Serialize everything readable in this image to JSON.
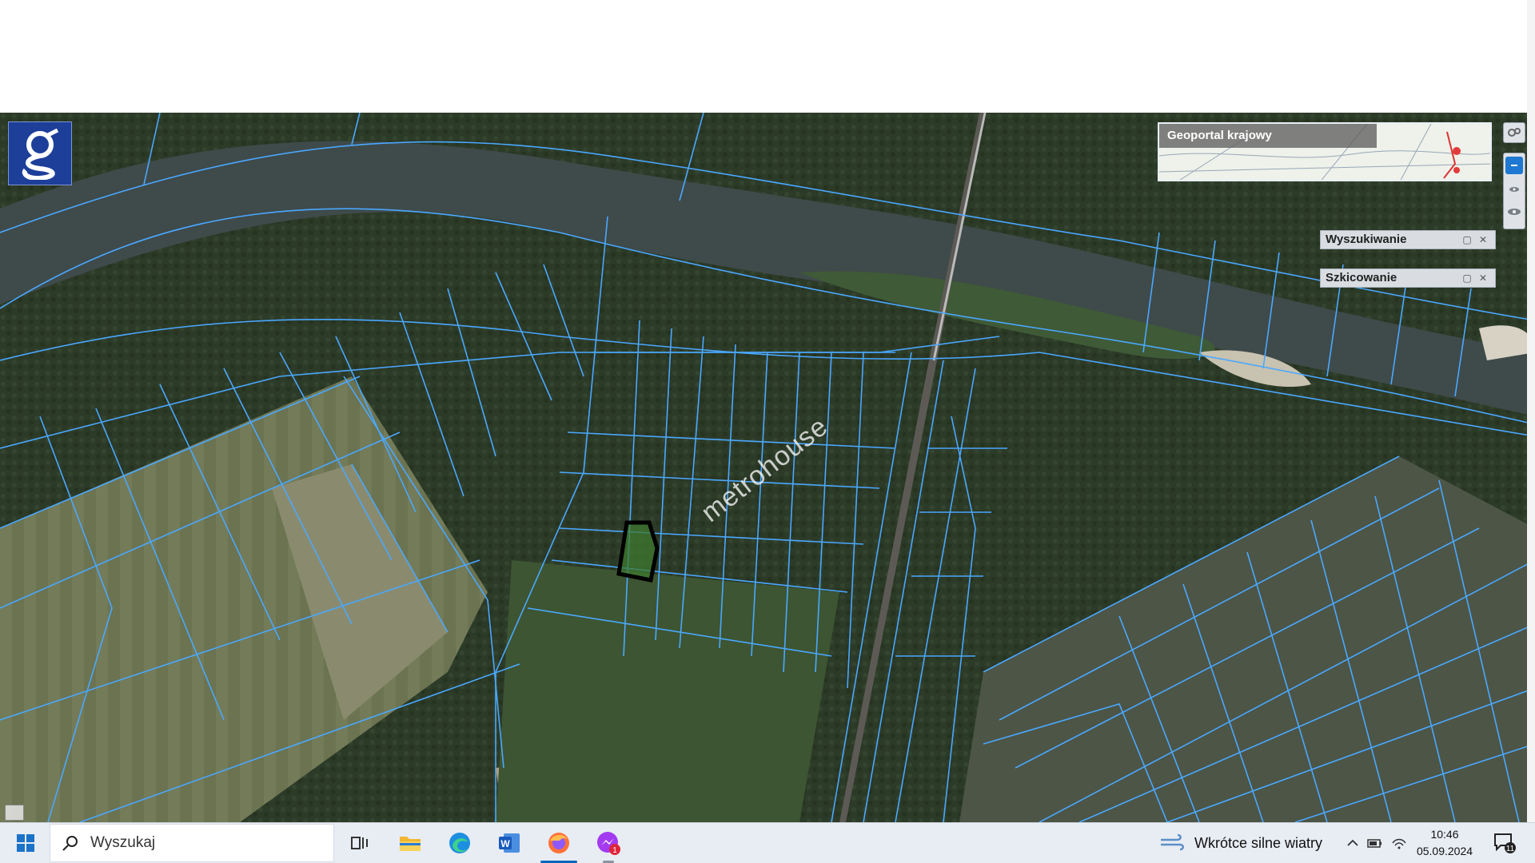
{
  "map": {
    "overview_title": "Geoportal krajowy",
    "watermark": "metrohouse",
    "panels": [
      {
        "title": "Wyszukiwanie"
      },
      {
        "title": "Szkicowanie"
      }
    ],
    "parcel_outline_color": "#4aa8ff",
    "selected_parcel_color": "#000000"
  },
  "taskbar": {
    "search_placeholder": "Wyszukaj",
    "weather_text": "Wkrótce silne wiatry",
    "time": "10:46",
    "date": "05.09.2024",
    "notification_count": "11",
    "chat_badge": "1"
  },
  "icons": [
    "windows-start-icon",
    "search-icon",
    "task-view-icon",
    "file-explorer-icon",
    "edge-icon",
    "word-icon",
    "firefox-icon",
    "messenger-icon",
    "wind-icon",
    "chevron-up-icon",
    "battery-icon",
    "network-icon",
    "notification-icon",
    "settings-icon",
    "zoom-in-icon",
    "eye-icon"
  ]
}
